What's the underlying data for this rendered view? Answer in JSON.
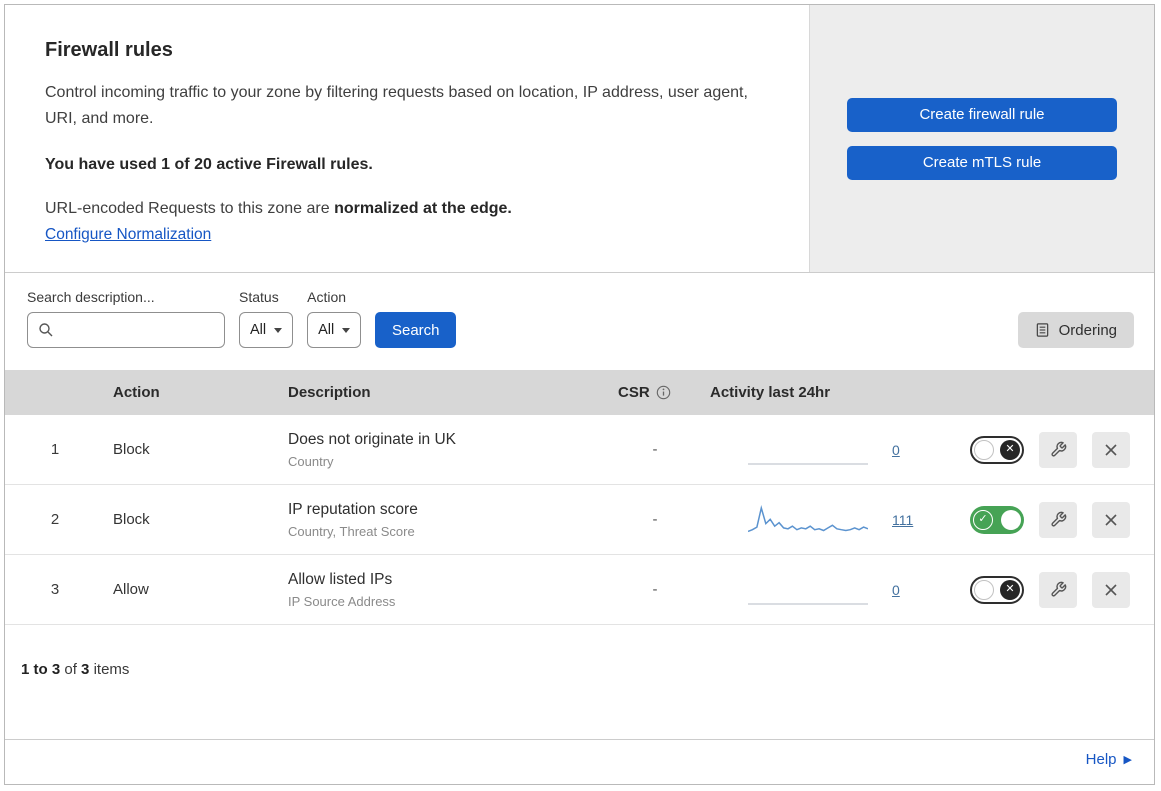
{
  "header": {
    "title": "Firewall rules",
    "description": "Control incoming traffic to your zone by filtering requests based on location, IP address, user agent, URI, and more.",
    "usage": "You have used 1 of 20 active Firewall rules.",
    "normalization_prefix": "URL-encoded Requests to this zone are",
    "normalization_bold": "normalized at the edge.",
    "normalization_link": "Configure Normalization",
    "buttons": {
      "create_firewall": "Create firewall rule",
      "create_mtls": "Create mTLS rule"
    }
  },
  "filters": {
    "search_label": "Search description...",
    "status_label": "Status",
    "status_value": "All",
    "action_label": "Action",
    "action_value": "All",
    "search_button": "Search",
    "ordering_button": "Ordering"
  },
  "table": {
    "columns": {
      "action": "Action",
      "description": "Description",
      "csr": "CSR",
      "activity": "Activity last 24hr"
    },
    "rows": [
      {
        "index": "1",
        "action": "Block",
        "description": "Does not originate in UK",
        "fields": "Country",
        "csr": "-",
        "count": "0",
        "enabled": false,
        "spark": []
      },
      {
        "index": "2",
        "action": "Block",
        "description": "IP reputation score",
        "fields": "Country, Threat Score",
        "csr": "-",
        "count": "111",
        "enabled": true,
        "spark": [
          3,
          5,
          8,
          30,
          12,
          17,
          9,
          13,
          7,
          6,
          9,
          5,
          7,
          6,
          9,
          5,
          6,
          4,
          7,
          10,
          6,
          5,
          4,
          5,
          7,
          5,
          8,
          6
        ]
      },
      {
        "index": "3",
        "action": "Allow",
        "description": "Allow listed IPs",
        "fields": "IP Source Address",
        "csr": "-",
        "count": "0",
        "enabled": false,
        "spark": []
      }
    ],
    "summary": {
      "range": "1 to 3",
      "of": "of",
      "total": "3",
      "items": "items"
    }
  },
  "help": {
    "label": "Help"
  },
  "colors": {
    "accent_blue": "#1861c9",
    "toggle_green": "#46a355",
    "link_blue": "#1656c4",
    "count_link": "#43719f",
    "spark_blue": "#5b93cf",
    "header_gray": "#d7d7d7",
    "panel_gray": "#ededed"
  }
}
